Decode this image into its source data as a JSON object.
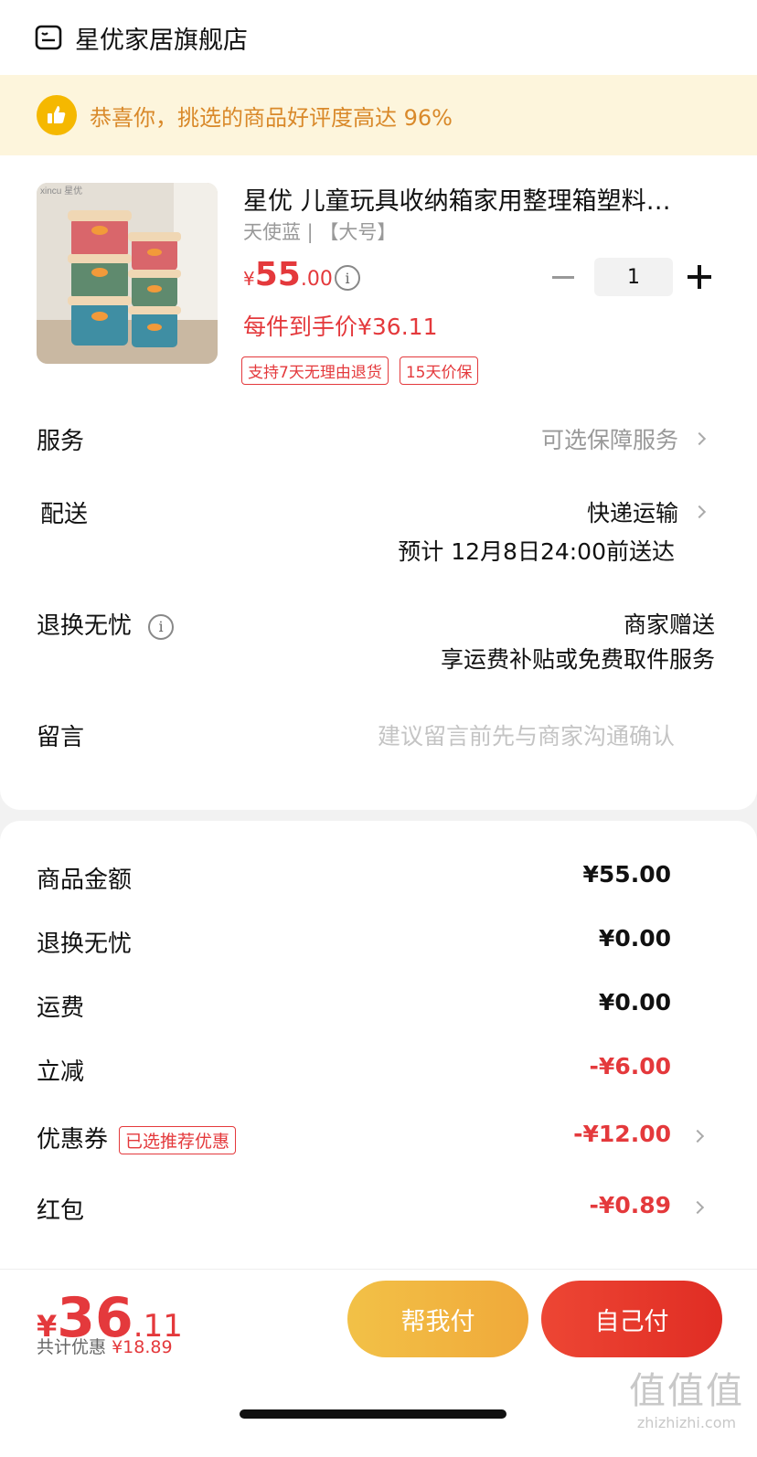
{
  "store": {
    "name": "星优家居旗舰店",
    "icon": "store-icon"
  },
  "praise": {
    "icon": "thumbs-up-icon",
    "text": "恭喜你，挑选的商品好评度高达 96%"
  },
  "product": {
    "title": "星优  儿童玩具收纳箱家用整理箱塑料…",
    "spec": "天使蓝 | 【大号】",
    "price_currency": "¥",
    "price_int": "55",
    "price_dec": ".00",
    "quantity": "1",
    "net_price": "每件到手价¥36.11",
    "tags": [
      "支持7天无理由退货",
      "15天价保"
    ],
    "image_label": "xincu 星优"
  },
  "rows": {
    "service": {
      "label": "服务",
      "value": "可选保障服务"
    },
    "delivery": {
      "label": "配送",
      "value": "快递运输",
      "eta": "预计 12月8日24:00前送达"
    },
    "returns": {
      "label": "退换无忧",
      "value": "商家赠送",
      "sub": "享运费补贴或免费取件服务"
    },
    "message": {
      "label": "留言",
      "placeholder": "建议留言前先与商家沟通确认"
    }
  },
  "summary": {
    "goods": {
      "label": "商品金额",
      "value": "¥55.00"
    },
    "returns": {
      "label": "退换无忧",
      "value": "¥0.00"
    },
    "shipping": {
      "label": "运费",
      "value": "¥0.00"
    },
    "discount": {
      "label": "立减",
      "value": "-¥6.00"
    },
    "coupon": {
      "label": "优惠券",
      "tag": "已选推荐优惠",
      "value": "-¥12.00"
    },
    "redpacket": {
      "label": "红包",
      "value": "-¥0.89"
    }
  },
  "footer": {
    "total_currency": "¥",
    "total_int": "36",
    "total_dec": ".11",
    "saved_label": "共计优惠",
    "saved_amount": "¥18.89",
    "help_pay": "帮我付",
    "self_pay": "自己付"
  },
  "watermark": {
    "line1": "值值值",
    "line2": "zhizhizhi.com"
  },
  "colors": {
    "accent": "#e4393c",
    "help_button": "#f0a93a",
    "banner_bg": "#fdf5dc"
  }
}
